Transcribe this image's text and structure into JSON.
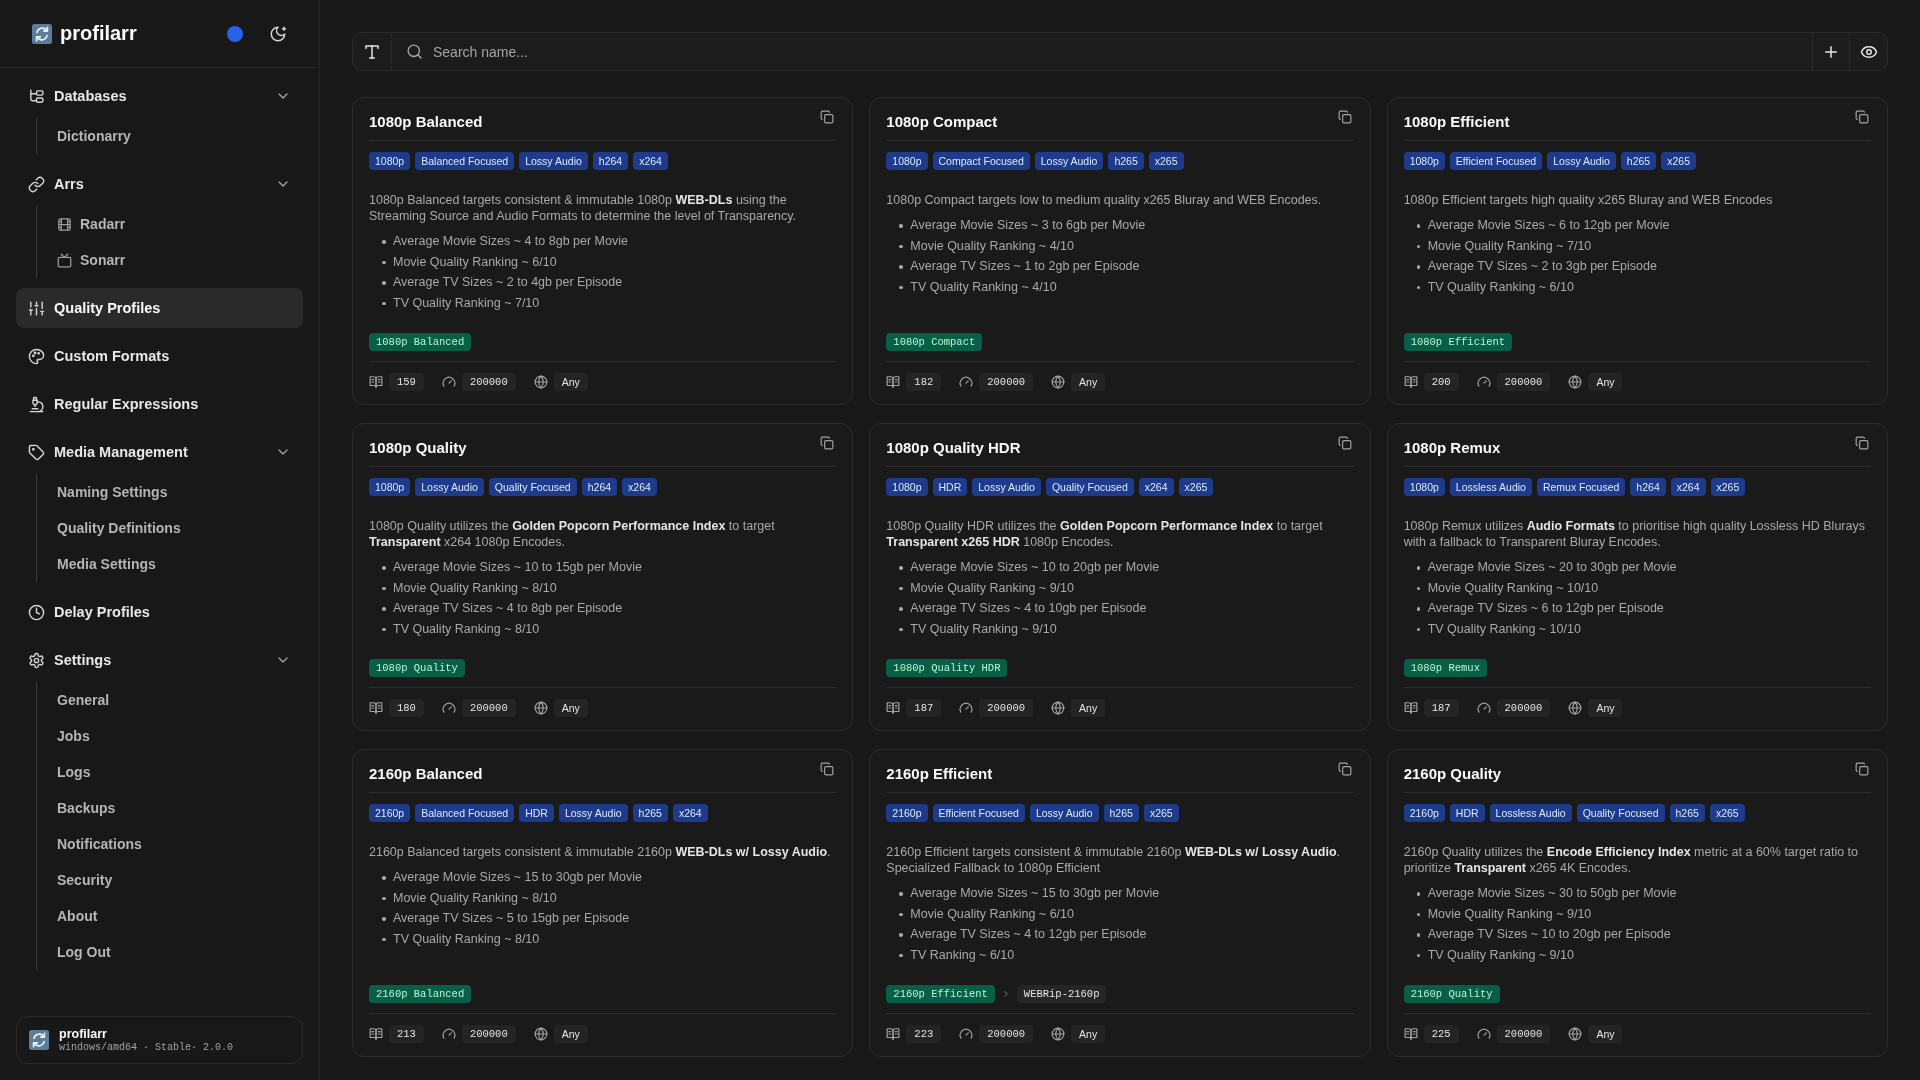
{
  "sidebar": {
    "brand": "profilarr",
    "nav": [
      {
        "label": "Databases",
        "kind": "group",
        "expanded": true,
        "selected": false,
        "children": [
          {
            "label": "Dictionarry",
            "selected": false
          }
        ]
      },
      {
        "label": "Arrs",
        "kind": "group",
        "expanded": true,
        "selected": false,
        "children": [
          {
            "label": "Radarr",
            "selected": false
          },
          {
            "label": "Sonarr",
            "selected": false
          }
        ]
      },
      {
        "label": "Quality Profiles",
        "kind": "link",
        "selected": true
      },
      {
        "label": "Custom Formats",
        "kind": "link",
        "selected": false
      },
      {
        "label": "Regular Expressions",
        "kind": "link",
        "selected": false
      },
      {
        "label": "Media Management",
        "kind": "group",
        "expanded": true,
        "selected": false,
        "children": [
          {
            "label": "Naming Settings",
            "selected": false
          },
          {
            "label": "Quality Definitions",
            "selected": false
          },
          {
            "label": "Media Settings",
            "selected": false
          }
        ]
      },
      {
        "label": "Delay Profiles",
        "kind": "link",
        "selected": false
      },
      {
        "label": "Settings",
        "kind": "group",
        "expanded": true,
        "selected": false,
        "children": [
          {
            "label": "General",
            "selected": false
          },
          {
            "label": "Jobs",
            "selected": false
          },
          {
            "label": "Logs",
            "selected": false
          },
          {
            "label": "Backups",
            "selected": false
          },
          {
            "label": "Notifications",
            "selected": false
          },
          {
            "label": "Security",
            "selected": false
          },
          {
            "label": "About",
            "selected": false
          },
          {
            "label": "Log Out",
            "selected": false
          }
        ]
      }
    ],
    "footer": {
      "name": "profilarr",
      "build": "windows/amd64 · Stable· 2.0.0"
    }
  },
  "toolbar": {
    "search": {
      "placeholder": "Search name..."
    }
  },
  "profiles": [
    {
      "title": "1080p Balanced",
      "tags": [
        "1080p",
        "Balanced Focused",
        "Lossy Audio",
        "h264",
        "x264"
      ],
      "description": "1080p Balanced targets consistent & immutable 1080p **WEB-DLs** using the Streaming Source and Audio Formats to determine the level of Transparency.",
      "bullets": [
        "Average Movie Sizes ~ 4 to 8gb per Movie",
        "Movie Quality Ranking ~ 6/10",
        "Average TV Sizes ~ 2 to 4gb per Episode",
        "TV Quality Ranking ~ 7/10"
      ],
      "formats": [
        "1080p Balanced"
      ],
      "stats": {
        "count": "159",
        "score": "200000",
        "language": "Any"
      }
    },
    {
      "title": "1080p Compact",
      "tags": [
        "1080p",
        "Compact Focused",
        "Lossy Audio",
        "h265",
        "x265"
      ],
      "description": "1080p Compact targets low to medium quality x265 Bluray and WEB Encodes.",
      "bullets": [
        "Average Movie Sizes ~ 3 to 6gb per Movie",
        "Movie Quality Ranking ~ 4/10",
        "Average TV Sizes ~ 1 to 2gb per Episode",
        "TV Quality Ranking ~ 4/10"
      ],
      "formats": [
        "1080p Compact"
      ],
      "stats": {
        "count": "182",
        "score": "200000",
        "language": "Any"
      }
    },
    {
      "title": "1080p Efficient",
      "tags": [
        "1080p",
        "Efficient Focused",
        "Lossy Audio",
        "h265",
        "x265"
      ],
      "description": "1080p Efficient targets high quality x265 Bluray and WEB Encodes",
      "bullets": [
        "Average Movie Sizes ~ 6 to 12gb per Movie",
        "Movie Quality Ranking ~ 7/10",
        "Average TV Sizes ~ 2 to 3gb per Episode",
        "TV Quality Ranking ~ 6/10"
      ],
      "formats": [
        "1080p Efficient"
      ],
      "stats": {
        "count": "200",
        "score": "200000",
        "language": "Any"
      }
    },
    {
      "title": "1080p Quality",
      "tags": [
        "1080p",
        "Lossy Audio",
        "Quality Focused",
        "h264",
        "x264"
      ],
      "description": "1080p Quality utilizes the **Golden Popcorn Performance Index** to target **Transparent** x264 1080p Encodes.",
      "bullets": [
        "Average Movie Sizes ~ 10 to 15gb per Movie",
        "Movie Quality Ranking ~ 8/10",
        "Average TV Sizes ~ 4 to 8gb per Episode",
        "TV Quality Ranking ~ 8/10"
      ],
      "formats": [
        "1080p Quality"
      ],
      "stats": {
        "count": "180",
        "score": "200000",
        "language": "Any"
      }
    },
    {
      "title": "1080p Quality HDR",
      "tags": [
        "1080p",
        "HDR",
        "Lossy Audio",
        "Quality Focused",
        "x264",
        "x265"
      ],
      "description": "1080p Quality HDR utilizes the **Golden Popcorn Performance Index** to target **Transparent x265 HDR** 1080p Encodes.",
      "bullets": [
        "Average Movie Sizes ~ 10 to 20gb per Movie",
        "Movie Quality Ranking ~ 9/10",
        "Average TV Sizes ~ 4 to 10gb per Episode",
        "TV Quality Ranking ~ 9/10"
      ],
      "formats": [
        "1080p Quality HDR"
      ],
      "stats": {
        "count": "187",
        "score": "200000",
        "language": "Any"
      }
    },
    {
      "title": "1080p Remux",
      "tags": [
        "1080p",
        "Lossless Audio",
        "Remux Focused",
        "h264",
        "x264",
        "x265"
      ],
      "description": "1080p Remux utilizes **Audio Formats** to prioritise high quality Lossless HD Blurays with a fallback to Transparent Bluray Encodes.",
      "bullets": [
        "Average Movie Sizes ~ 20 to 30gb per Movie",
        "Movie Quality Ranking ~ 10/10",
        "Average TV Sizes ~ 6 to 12gb per Episode",
        "TV Quality Ranking ~ 10/10"
      ],
      "formats": [
        "1080p Remux"
      ],
      "stats": {
        "count": "187",
        "score": "200000",
        "language": "Any"
      }
    },
    {
      "title": "2160p Balanced",
      "tags": [
        "2160p",
        "Balanced Focused",
        "HDR",
        "Lossy Audio",
        "h265",
        "x264"
      ],
      "description": "2160p Balanced targets consistent & immutable 2160p **WEB-DLs w/ Lossy Audio**.",
      "bullets": [
        "Average Movie Sizes ~ 15 to 30gb per Movie",
        "Movie Quality Ranking ~ 8/10",
        "Average TV Sizes ~ 5 to 15gb per Episode",
        "TV Quality Ranking ~ 8/10"
      ],
      "formats": [
        "2160p Balanced"
      ],
      "stats": {
        "count": "213",
        "score": "200000",
        "language": "Any"
      }
    },
    {
      "title": "2160p Efficient",
      "tags": [
        "2160p",
        "Efficient Focused",
        "Lossy Audio",
        "h265",
        "x265"
      ],
      "description": "2160p Efficient targets consistent & immutable 2160p **WEB-DLs w/ Lossy Audio**. Specialized Fallback to 1080p Efficient",
      "bullets": [
        "Average Movie Sizes ~ 15 to 30gb per Movie",
        "Movie Quality Ranking ~ 6/10",
        "Average TV Sizes ~ 4 to 12gb per Episode",
        "TV Ranking ~ 6/10"
      ],
      "formats": [
        "2160p Efficient",
        "WEBRip-2160p"
      ],
      "stats": {
        "count": "223",
        "score": "200000",
        "language": "Any"
      }
    },
    {
      "title": "2160p Quality",
      "tags": [
        "2160p",
        "HDR",
        "Lossless Audio",
        "Quality Focused",
        "h265",
        "x265"
      ],
      "description": "2160p Quality utilizes the **Encode Efficiency Index** metric at a 60% target ratio to prioritize **Transparent** x265 4K Encodes.",
      "bullets": [
        "Average Movie Sizes ~ 30 to 50gb per Movie",
        "Movie Quality Ranking ~ 9/10",
        "Average TV Sizes ~ 10 to 20gb per Episode",
        "TV Quality Ranking ~ 9/10"
      ],
      "formats": [
        "2160p Quality"
      ],
      "stats": {
        "count": "225",
        "score": "200000",
        "language": "Any"
      }
    }
  ]
}
